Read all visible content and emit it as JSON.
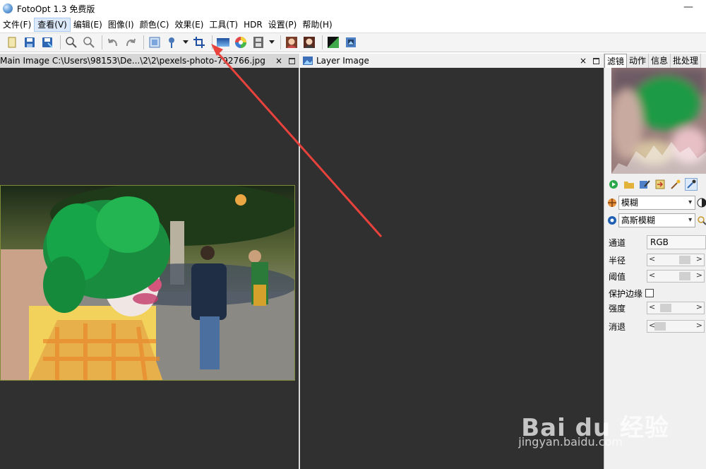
{
  "window": {
    "title": "FotoOpt 1.3 免费版",
    "minimize_glyph": "—"
  },
  "menu": [
    {
      "label": "文件(F)"
    },
    {
      "label": "查看(V)",
      "active": true
    },
    {
      "label": "编辑(E)"
    },
    {
      "label": "图像(I)"
    },
    {
      "label": "颜色(C)"
    },
    {
      "label": "效果(E)"
    },
    {
      "label": "工具(T)"
    },
    {
      "label": "HDR"
    },
    {
      "label": "设置(P)"
    },
    {
      "label": "帮助(H)"
    }
  ],
  "toolbar": {
    "icons": [
      "new-icon",
      "save-icon",
      "save-as-icon",
      "zoom-in-icon",
      "zoom-out-icon",
      "undo-icon",
      "redo-icon",
      "resize-icon",
      "brush-icon",
      "crop-icon",
      "gradient-icon",
      "color-wheel-icon",
      "filmstrip-icon",
      "portrait-icon",
      "portrait-alt-icon",
      "levels-icon",
      "image-icon"
    ]
  },
  "main_panel": {
    "title": "Main Image C:\\Users\\98153\\De...\\2\\2\\pexels-photo-792766.jpg",
    "close_glyph": "×"
  },
  "layer_panel": {
    "title": "Layer Image",
    "close_glyph": "×"
  },
  "right_panel": {
    "tabs": [
      {
        "label": "滤镜",
        "active": true
      },
      {
        "label": "动作"
      },
      {
        "label": "信息"
      },
      {
        "label": "批处理"
      }
    ],
    "filter_category": "模糊",
    "filter_type": "高斯模糊",
    "channel_label": "通道",
    "channel_value": "RGB",
    "params": [
      {
        "label": "半径"
      },
      {
        "label": "阈值"
      },
      {
        "label": "保护边缘"
      },
      {
        "label": "强度"
      },
      {
        "label": "消退"
      }
    ],
    "slider_left": "<",
    "slider_right": ">"
  },
  "watermark": {
    "logo": "Bai du 经验",
    "url": "jingyan.baidu.com"
  },
  "colors": {
    "canvas_bg": "#303030",
    "arrow": "#e8423c",
    "accent_blue": "#2f66b3"
  }
}
